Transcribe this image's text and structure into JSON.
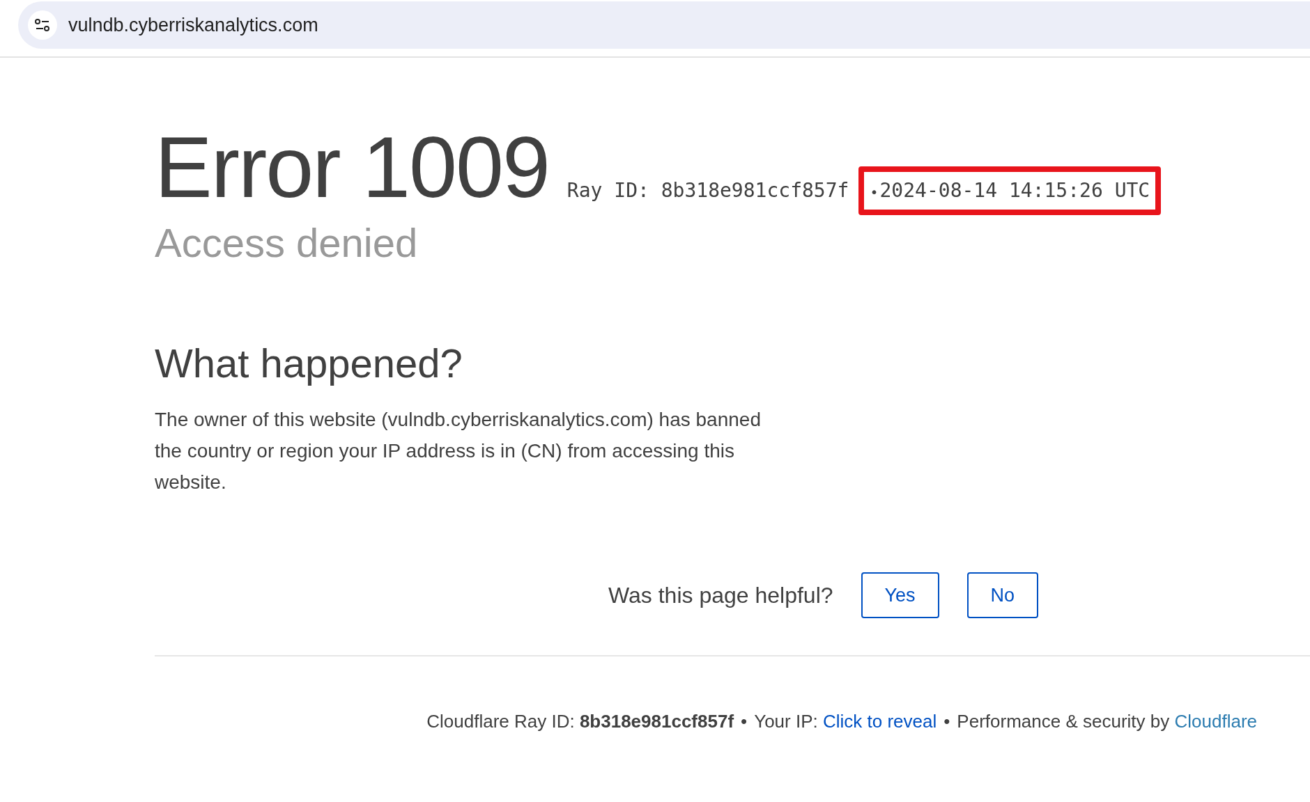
{
  "address_bar": {
    "url": "vulndb.cyberriskanalytics.com"
  },
  "header": {
    "title": "Error 1009",
    "ray_id": "Ray ID: 8b318e981ccf857f",
    "separator": "•",
    "timestamp": "2024-08-14 14:15:26 UTC",
    "timestamp_highlighted": true,
    "subtitle": "Access denied"
  },
  "section": {
    "heading": "What happened?",
    "body": "The owner of this website (vulndb.cyberriskanalytics.com) has banned the country or region your IP address is in (CN) from accessing this website."
  },
  "feedback": {
    "question": "Was this page helpful?",
    "buttons": [
      "Yes",
      "No"
    ]
  },
  "footer": [
    {
      "kind": "text",
      "text": "Cloudflare Ray ID: "
    },
    {
      "kind": "bold",
      "text": "8b318e981ccf857f"
    },
    {
      "kind": "sep",
      "text": "•"
    },
    {
      "kind": "text",
      "text": "Your IP: "
    },
    {
      "kind": "link",
      "text": "Click to reveal"
    },
    {
      "kind": "sep",
      "text": "•"
    },
    {
      "kind": "text",
      "text": "Performance & security by "
    },
    {
      "kind": "brand",
      "text": "Cloudflare"
    }
  ]
}
